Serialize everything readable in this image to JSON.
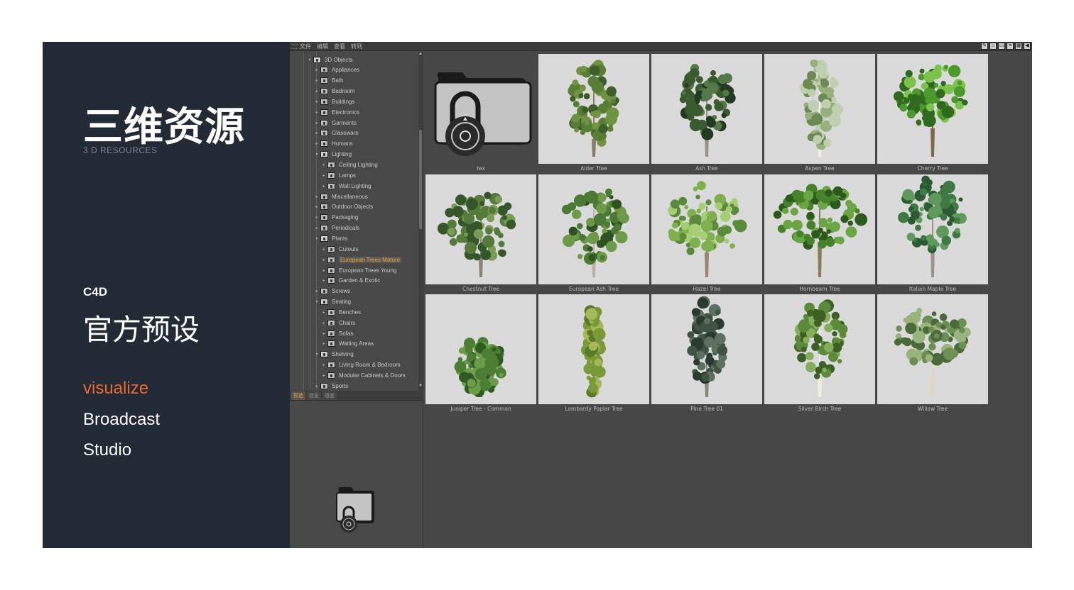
{
  "slide": {
    "title_cn": "三维资源",
    "subtitle_en": "3 D RESOURCES",
    "product": "C4D",
    "preset_title": "官方预设",
    "nav": [
      {
        "label": "visualize",
        "active": true
      },
      {
        "label": "Broadcast",
        "active": false
      },
      {
        "label": "Studio",
        "active": false
      }
    ],
    "accent_color": "#e86a2c",
    "panel_color": "#222a36"
  },
  "app": {
    "menu": [
      "文件",
      "编辑",
      "查看",
      "转到"
    ],
    "tabs": [
      {
        "label": "预选",
        "active": true
      },
      {
        "label": "信息",
        "active": false
      },
      {
        "label": "语言",
        "active": false
      }
    ],
    "tree": [
      {
        "label": "3D Objects",
        "level": 0,
        "open": true
      },
      {
        "label": "Appliances",
        "level": 1
      },
      {
        "label": "Bath",
        "level": 1
      },
      {
        "label": "Bedroom",
        "level": 1
      },
      {
        "label": "Buildings",
        "level": 1
      },
      {
        "label": "Electronics",
        "level": 1
      },
      {
        "label": "Garments",
        "level": 1
      },
      {
        "label": "Glassware",
        "level": 1
      },
      {
        "label": "Humans",
        "level": 1
      },
      {
        "label": "Lighting",
        "level": 1,
        "open": true
      },
      {
        "label": "Ceiling Lighting",
        "level": 2
      },
      {
        "label": "Lamps",
        "level": 2
      },
      {
        "label": "Wall Lighting",
        "level": 2
      },
      {
        "label": "Miscellaneous",
        "level": 1
      },
      {
        "label": "Outdoor Objects",
        "level": 1
      },
      {
        "label": "Packaging",
        "level": 1
      },
      {
        "label": "Periodicals",
        "level": 1
      },
      {
        "label": "Plants",
        "level": 1,
        "open": true
      },
      {
        "label": "Cutouts",
        "level": 2
      },
      {
        "label": "European Trees Mature",
        "level": 2,
        "selected": true
      },
      {
        "label": "European Trees Young",
        "level": 2
      },
      {
        "label": "Garden & Exotic",
        "level": 2
      },
      {
        "label": "Screws",
        "level": 1
      },
      {
        "label": "Seating",
        "level": 1,
        "open": true
      },
      {
        "label": "Benches",
        "level": 2
      },
      {
        "label": "Chairs",
        "level": 2
      },
      {
        "label": "Sofas",
        "level": 2
      },
      {
        "label": "Waiting Areas",
        "level": 2
      },
      {
        "label": "Shelving",
        "level": 1,
        "open": true
      },
      {
        "label": "Living Room & Bedroom",
        "level": 2
      },
      {
        "label": "Modular Cabinets & Doors",
        "level": 2
      },
      {
        "label": "Sports",
        "level": 1
      }
    ],
    "items": [
      {
        "label": "tex",
        "icon": "locked-folder-icon"
      },
      {
        "label": "Alder Tree",
        "icon": "tree-icon"
      },
      {
        "label": "Ash Tree",
        "icon": "tree-icon"
      },
      {
        "label": "Aspen Tree",
        "icon": "tree-icon"
      },
      {
        "label": "Cherry Tree",
        "icon": "tree-icon"
      },
      {
        "label": "Chestnut Tree",
        "icon": "tree-icon"
      },
      {
        "label": "European Ash Tree",
        "icon": "tree-icon"
      },
      {
        "label": "Hazel Tree",
        "icon": "tree-icon"
      },
      {
        "label": "Hornbeam Tree",
        "icon": "tree-icon"
      },
      {
        "label": "Italian Maple Tree",
        "icon": "tree-icon"
      },
      {
        "label": "Juniper Tree - Common",
        "icon": "tree-icon"
      },
      {
        "label": "Lombardy Poplar Tree",
        "icon": "tree-icon"
      },
      {
        "label": "Pine Tree 01",
        "icon": "tree-icon"
      },
      {
        "label": "Silver Birch Tree",
        "icon": "tree-icon"
      },
      {
        "label": "Willow Tree",
        "icon": "tree-icon"
      }
    ]
  }
}
